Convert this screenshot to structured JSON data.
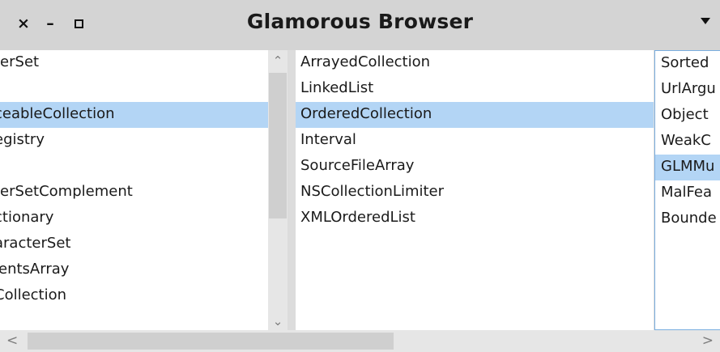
{
  "window": {
    "title": "Glamorous Browser",
    "close_glyph": "×",
    "minimize_glyph": "–",
    "menu_icon": "dropdown-caret"
  },
  "panes": [
    {
      "items": [
        {
          "label": "terSet",
          "selected": false
        },
        {
          "label": "",
          "selected": false
        },
        {
          "label": "ceableCollection",
          "selected": true
        },
        {
          "label": "egistry",
          "selected": false
        },
        {
          "label": "",
          "selected": false
        },
        {
          "label": "terSetComplement",
          "selected": false
        },
        {
          "label": "ctionary",
          "selected": false
        },
        {
          "label": "aracterSet",
          "selected": false
        },
        {
          "label": "lentsArray",
          "selected": false
        },
        {
          "label": "Collection",
          "selected": false
        }
      ]
    },
    {
      "items": [
        {
          "label": "ArrayedCollection",
          "selected": false
        },
        {
          "label": "LinkedList",
          "selected": false
        },
        {
          "label": "OrderedCollection",
          "selected": true
        },
        {
          "label": "Interval",
          "selected": false
        },
        {
          "label": "SourceFileArray",
          "selected": false
        },
        {
          "label": "NSCollectionLimiter",
          "selected": false
        },
        {
          "label": "XMLOrderedList",
          "selected": false
        }
      ]
    },
    {
      "items": [
        {
          "label": "Sorted",
          "selected": false
        },
        {
          "label": "UrlArgu",
          "selected": false
        },
        {
          "label": "Object",
          "selected": false
        },
        {
          "label": "WeakC",
          "selected": false
        },
        {
          "label": "GLMMu",
          "selected": true
        },
        {
          "label": "MalFea",
          "selected": false
        },
        {
          "label": "Bounde",
          "selected": false
        }
      ]
    }
  ],
  "scrollbars": {
    "up_glyph": "⌃",
    "down_glyph": "⌄",
    "left_glyph": "<",
    "right_glyph": ">"
  }
}
